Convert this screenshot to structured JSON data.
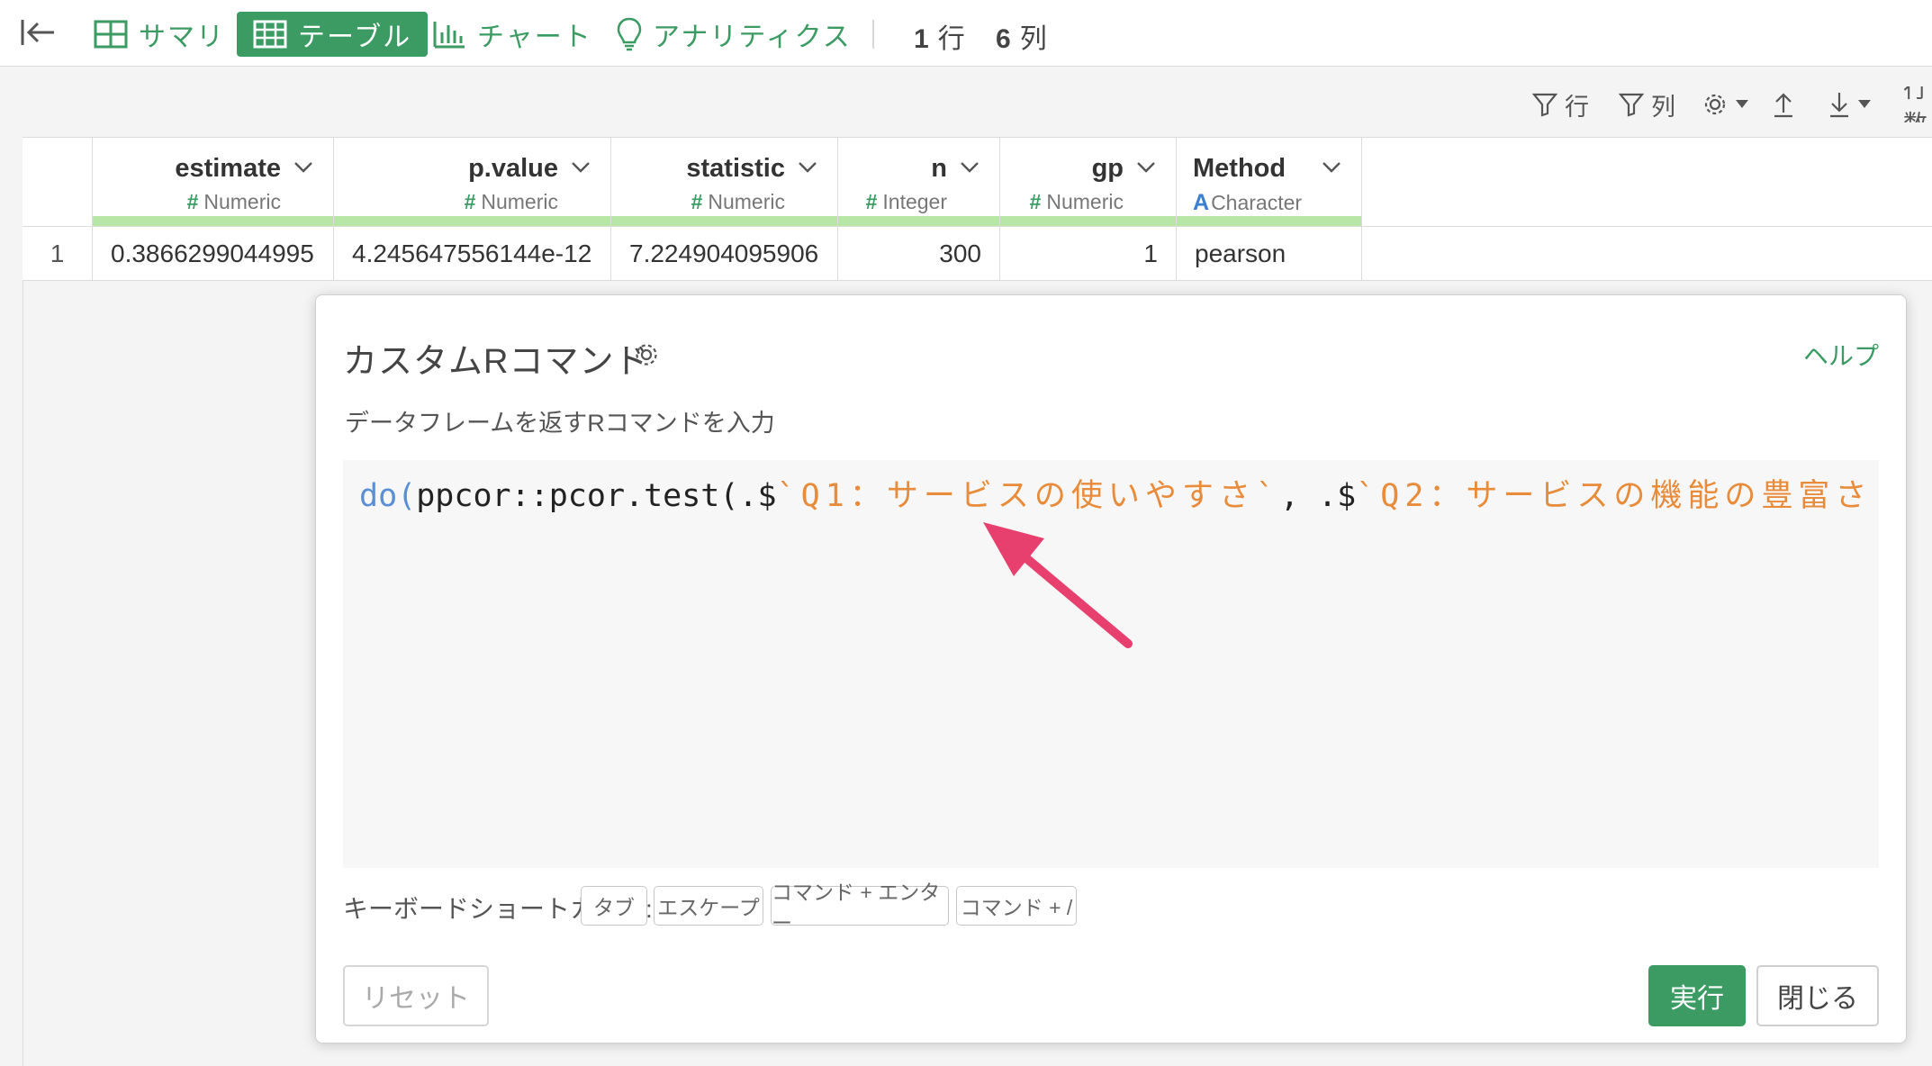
{
  "topbar": {
    "tabs": [
      {
        "label": "サマリ",
        "icon": "summary-grid-icon",
        "active": false
      },
      {
        "label": "テーブル",
        "icon": "table-icon",
        "active": true
      },
      {
        "label": "チャート",
        "icon": "bar-chart-icon",
        "active": false
      },
      {
        "label": "アナリティクス",
        "icon": "lightbulb-icon",
        "active": false
      }
    ],
    "rows_count": "1",
    "rows_unit": "行",
    "cols_count": "6",
    "cols_unit": "列"
  },
  "toolbar": {
    "filter_rows_label": "行",
    "filter_cols_label": "列",
    "truncated_label": "行数"
  },
  "table": {
    "columns": [
      {
        "name": "estimate",
        "type": "Numeric",
        "type_icon": "#"
      },
      {
        "name": "p.value",
        "type": "Numeric",
        "type_icon": "#"
      },
      {
        "name": "statistic",
        "type": "Numeric",
        "type_icon": "#"
      },
      {
        "name": "n",
        "type": "Integer",
        "type_icon": "#"
      },
      {
        "name": "gp",
        "type": "Numeric",
        "type_icon": "#"
      },
      {
        "name": "Method",
        "type": "Character",
        "type_icon": "A"
      }
    ],
    "rows": [
      {
        "index": "1",
        "cells": [
          "0.3866299044995",
          "4.245647556144e-12",
          "7.224904095906",
          "300",
          "1",
          "pearson"
        ]
      }
    ]
  },
  "dialog": {
    "title": "カスタムRコマンド",
    "help": "ヘルプ",
    "subtitle": "データフレームを返すRコマンドを入力",
    "code": {
      "kw": "do",
      "open": "(",
      "p1": "ppcor::pcor.test(.$",
      "s1": "`Q1：サービスの使いやすさ`",
      "p2": ", .$",
      "s2": "`Q2：サービスの機能の豊富さ"
    },
    "shortcut_label": "キーボードショートカット:",
    "shortcuts": [
      "タブ",
      "エスケープ",
      "コマンド + エンター",
      "コマンド + /"
    ],
    "reset": "リセット",
    "run": "実行",
    "close": "閉じる"
  },
  "colors": {
    "accent": "#3b9b63",
    "header_bar": "#b8e6a6",
    "string": "#e88b3a",
    "keyword": "#5a8fd6",
    "annotation_arrow": "#e8406e"
  }
}
